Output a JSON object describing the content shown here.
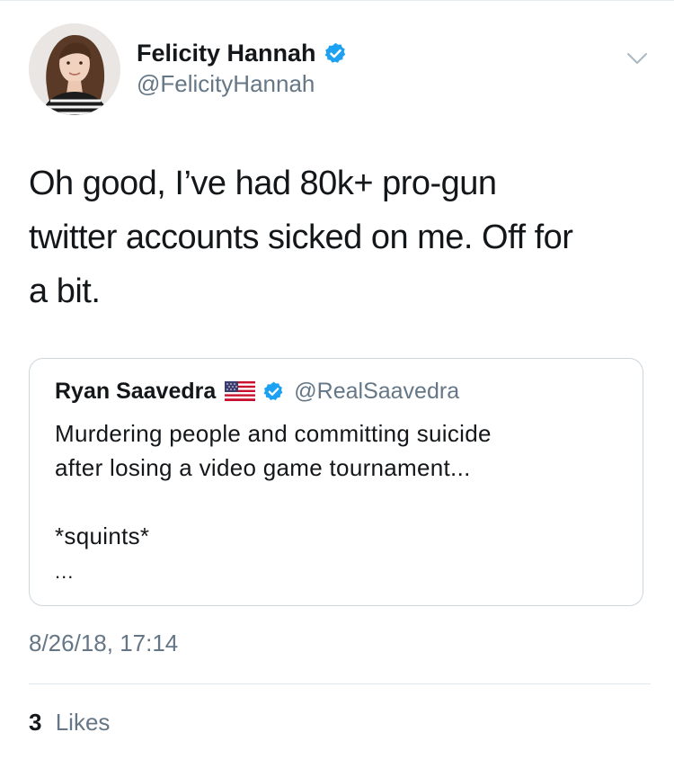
{
  "tweet": {
    "author": {
      "display_name": "Felicity Hannah",
      "handle": "@FelicityHannah",
      "verified": true,
      "avatar_icon": "profile-photo"
    },
    "text": "Oh good, I’ve had 80k+ pro-gun\ntwitter accounts sicked on me. Off for\na bit.",
    "menu_icon": "chevron-down-icon",
    "timestamp": "8/26/18, 17:14",
    "likes": {
      "count": "3",
      "label": "Likes"
    }
  },
  "quoted_tweet": {
    "display_name": "Ryan Saavedra",
    "flag_icon": "us-flag-icon",
    "verified": true,
    "handle": "@RealSaavedra",
    "lines": [
      "Murdering people and committing suicide",
      "after losing a video game tournament...",
      "*squints*"
    ],
    "ellipsis": "..."
  },
  "colors": {
    "text_primary": "#14171a",
    "text_secondary": "#657786",
    "verified_blue": "#1da1f2",
    "border": "#ccd6dd"
  }
}
